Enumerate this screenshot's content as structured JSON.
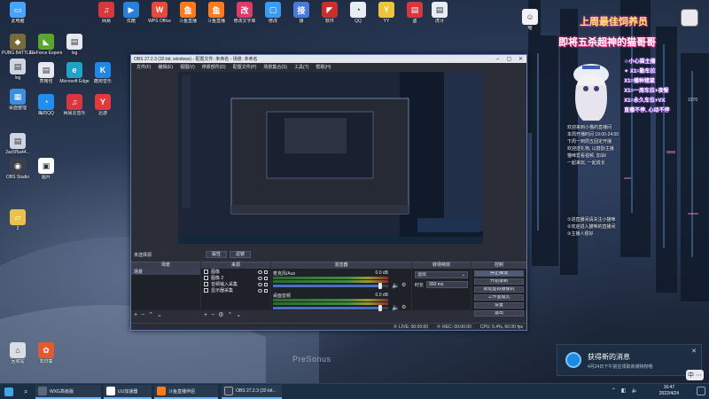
{
  "desktop": {
    "icons": [
      {
        "label": "此电脑",
        "color": "#4aa3ff",
        "glyph": "▭"
      },
      {
        "label": "PUBG BATTLEGR...",
        "color": "#7a6a3a",
        "glyph": "◆"
      },
      {
        "label": "log",
        "color": "#cfd6e2",
        "glyph": "▤"
      },
      {
        "label": "桌面整理",
        "color": "#3a8fe0",
        "glyph": "▦"
      },
      {
        "label": "2ac5f5a44...",
        "color": "#cfd6e2",
        "glyph": "▤"
      },
      {
        "label": "OBS Studio",
        "color": "#3b3f4a",
        "glyph": "◉"
      },
      {
        "label": "2",
        "color": "#e8c34a",
        "glyph": "▱"
      },
      {
        "label": "回收站",
        "color": "#d9dde4",
        "glyph": "⌂"
      },
      {
        "label": "GeForce Experience",
        "color": "#5aa62f",
        "glyph": "◣"
      },
      {
        "label": "表格包",
        "color": "#e6e9ef",
        "glyph": "▤"
      },
      {
        "label": "鹰的QQ",
        "color": "#1f8ef0",
        "glyph": "◔"
      },
      {
        "label": "图片",
        "color": "#ffffff",
        "glyph": "▣"
      },
      {
        "label": "向日葵",
        "color": "#e25b2f",
        "glyph": "✿"
      },
      {
        "label": "log",
        "color": "#e6e9ef",
        "glyph": "▤"
      },
      {
        "label": "Microsoft Edge",
        "color": "#1fa3c9",
        "glyph": "e"
      },
      {
        "label": "网易云音乐",
        "color": "#d9363e",
        "glyph": "♫"
      },
      {
        "label": "酷狗音乐",
        "color": "#1f87e8",
        "glyph": "K"
      },
      {
        "label": "迅游",
        "color": "#e03a3a",
        "glyph": "Y"
      },
      {
        "label": "网易",
        "color": "#d9363e",
        "glyph": "♫"
      },
      {
        "label": "优酷",
        "color": "#2a7fd6",
        "glyph": "▶"
      },
      {
        "label": "WPS Office",
        "color": "#e84a3a",
        "glyph": "W"
      },
      {
        "label": "斗鱼直播",
        "color": "#ff7a1a",
        "glyph": "鱼"
      },
      {
        "label": "斗鱼直播",
        "color": "#ff7a1a",
        "glyph": "鱼"
      },
      {
        "label": "修改文字库",
        "color": "#e03a6a",
        "glyph": "改"
      },
      {
        "label": "修改",
        "color": "#3a9cf0",
        "glyph": "▢"
      },
      {
        "label": "接",
        "color": "#4a7ad9",
        "glyph": "接"
      },
      {
        "label": "软件",
        "color": "#c9302c",
        "glyph": "◤"
      },
      {
        "label": "QQ",
        "color": "#e8edf3",
        "glyph": "◔"
      },
      {
        "label": "YY",
        "color": "#f0c43a",
        "glyph": "Y"
      },
      {
        "label": "盗",
        "color": "#d9363e",
        "glyph": "▤"
      },
      {
        "label": "虎牙",
        "color": "#e8edf3",
        "glyph": "▤"
      },
      {
        "label": "喵",
        "color": "#f2f2f6",
        "glyph": "☺"
      }
    ]
  },
  "overlay": {
    "line1": "上周最佳饲养员",
    "line2": "即将五杀超神的猫哥哥",
    "prizes": [
      "☆小心猫主播",
      "✦ X1=勤车拉",
      "X1=播种猪鼠",
      "X1=一周车拉+夜餐",
      "X1=永久车位+VX",
      "直播不停, 心动不停"
    ],
    "notes": [
      "欢迎来到小猫的直播间",
      "本周开播时间 19:00-24:00",
      "下周一到周五固定开播",
      "欢迎送礼物, 以鼓励主播",
      "猫咪爱看视频, 加油!",
      "一起来玩, 一起成长"
    ],
    "notes2": [
      "①进直播间请关注小猫咪",
      "②欢迎进入猫咪的直播间",
      "③主播人很好"
    ],
    "watermark": "1070"
  },
  "obs": {
    "title": "OBS 27.2.3 (32-bit, windows) - 配置文件: 未命名 - 场景: 未命名",
    "menu": [
      "文件(F)",
      "编辑(E)",
      "视图(V)",
      "停靠部件(D)",
      "配置文件(P)",
      "场景集合(S)",
      "工具(T)",
      "帮助(H)"
    ],
    "status_msg": "未选择源",
    "props_btn": "属性",
    "filter_btn": "滤镜",
    "docks": {
      "scenes": "场景",
      "sources": "来源",
      "mixer": "混音器",
      "transitions": "转场特效",
      "controls": "控制"
    },
    "scene_item": "场景",
    "sources": [
      {
        "name": "图像"
      },
      {
        "name": "图像 2"
      },
      {
        "name": "音频输入采集"
      },
      {
        "name": "显示器采集"
      }
    ],
    "mixer": [
      {
        "name": "麦克风/Aux",
        "db": "0.0 dB",
        "level": 0.93
      },
      {
        "name": "桌面音频",
        "db": "0.0 dB",
        "level": 0.93
      }
    ],
    "transition": {
      "type": "淡出",
      "duration_label": "时长",
      "duration": "300 ms"
    },
    "controls": [
      "停止推流",
      "开始录制",
      "启动虚拟摄像机",
      "工作室模式",
      "设置",
      "退出"
    ],
    "status": {
      "live": "LIVE: 00:00:00",
      "rec": "REC: 00:00:00",
      "cpu": "CPU: 5.4%, 60.00 fps"
    }
  },
  "wallpaper_brand": "PreSonus",
  "notification": {
    "title": "获得新的消息",
    "body": "4月24日下午前往领取商城特权哦",
    "accent": "#1c8be0"
  },
  "ime": {
    "label": "中"
  },
  "taskbar": {
    "apps": [
      {
        "label": "",
        "color": "#3fa7e8"
      },
      {
        "label": "WXG高级版",
        "color": "#5a6a80"
      },
      {
        "label": "UU加速器",
        "color": "#ffffff"
      },
      {
        "label": "斗鱼直播伴侣",
        "color": "#ff7a1a"
      },
      {
        "label": "OBS 27.2.3 (32-bit...",
        "color": "#3b3f4a"
      }
    ],
    "time": "16:47",
    "date": "2022/4/24"
  }
}
